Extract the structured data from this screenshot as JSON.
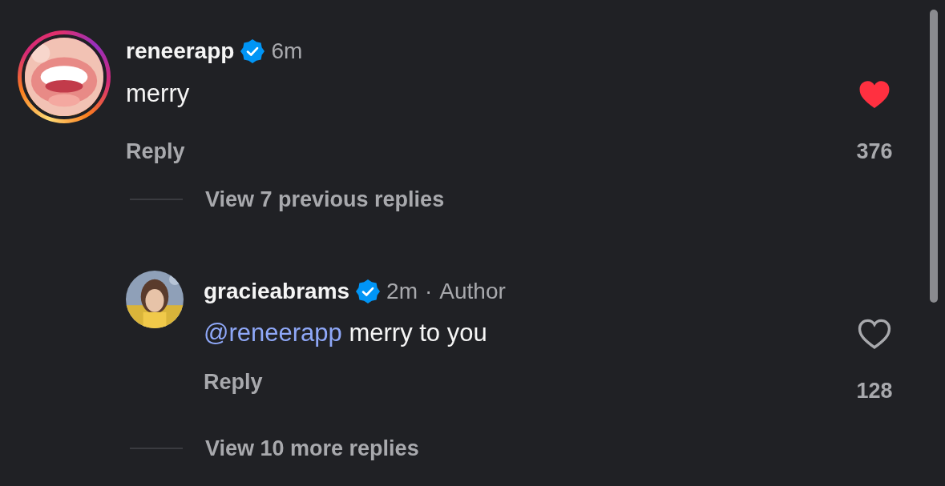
{
  "items": [
    {
      "kind": "comment",
      "has_story": true,
      "username": "reneerapp",
      "verified": true,
      "time": "6m",
      "text": "merry",
      "reply_label": "Reply",
      "liked": true,
      "like_count": "376"
    },
    {
      "kind": "thread-link",
      "text": "View 7 previous replies"
    },
    {
      "kind": "reply",
      "has_story": false,
      "username": "gracieabrams",
      "verified": true,
      "time": "2m",
      "separator": "·",
      "author_label": "Author",
      "mention": "@reneerapp",
      "text": "merry to you",
      "reply_label": "Reply",
      "liked": false,
      "like_count": "128"
    },
    {
      "kind": "thread-link",
      "text": "View 10 more replies"
    }
  ]
}
